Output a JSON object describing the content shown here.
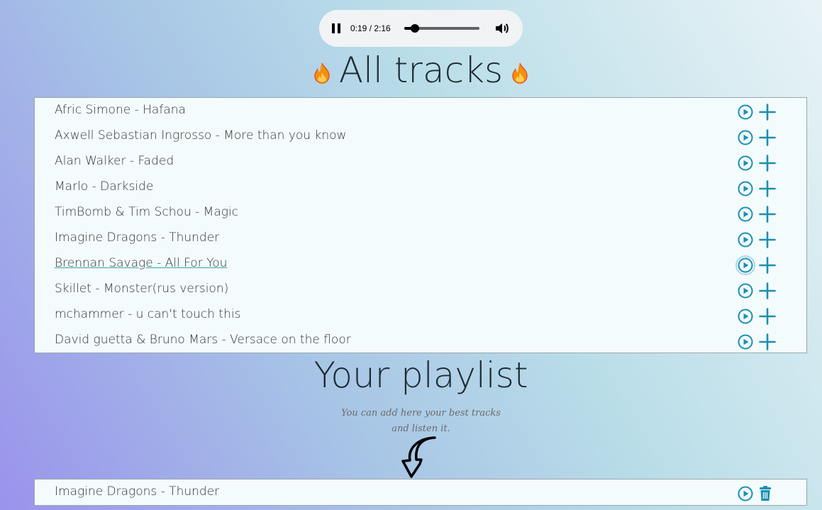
{
  "player": {
    "state_icon": "pause-icon",
    "time": "0:19 / 2:16",
    "progress": 0.14,
    "volume_icon": "volume-icon"
  },
  "all_tracks": {
    "title": "All tracks",
    "title_icon": "fire-icon",
    "tracks": [
      {
        "name": "Afric Simone - Hafana"
      },
      {
        "name": "Axwell Sebastian Ingrosso - More than you know"
      },
      {
        "name": "Alan Walker - Faded"
      },
      {
        "name": "Marlo - Darkside"
      },
      {
        "name": "TimBomb & Tim Schou - Magic"
      },
      {
        "name": "Imagine Dragons - Thunder"
      },
      {
        "name": "Brennan Savage - All For You"
      },
      {
        "name": "Skillet - Monster(rus version)"
      },
      {
        "name": "mchammer - u can't touch this"
      },
      {
        "name": "David guetta & Bruno Mars - Versace on the floor"
      }
    ]
  },
  "playlist": {
    "title": "Your playlist",
    "subtitle_line1": "You can add here your best tracks",
    "subtitle_line2": "and listen it.",
    "tracks": [
      {
        "name": "Imagine Dragons - Thunder"
      }
    ]
  },
  "colors": {
    "accent": "#1a8fb3",
    "list_bg": "#f3fbfd"
  }
}
